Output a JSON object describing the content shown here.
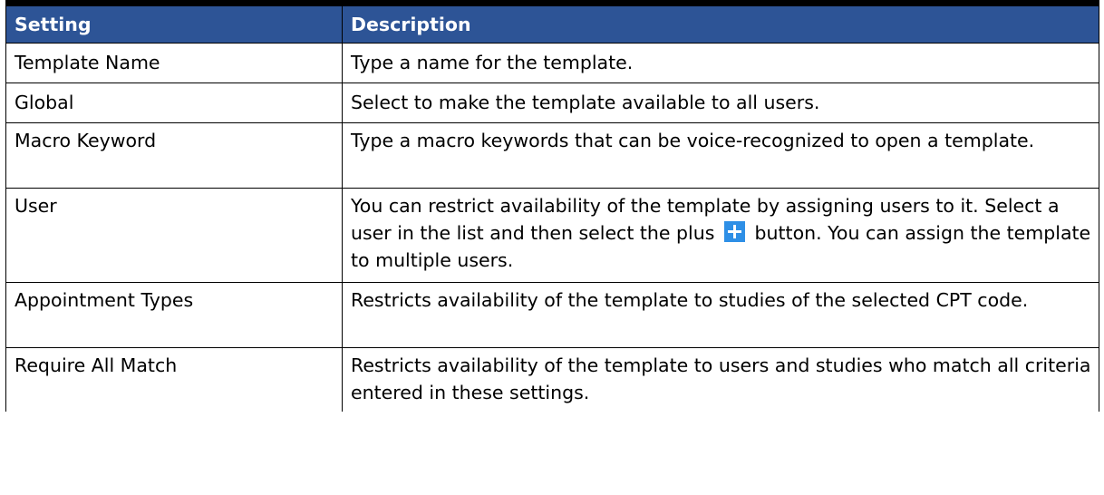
{
  "table": {
    "headers": {
      "setting": "Setting",
      "description": "Description"
    },
    "rows": [
      {
        "setting": "Template Name",
        "description": "Type a name for the template."
      },
      {
        "setting": "Global",
        "description": "Select to make the template available to all users."
      },
      {
        "setting": "Macro Keyword",
        "description": "Type a macro keywords that can be voice-recognized to open a template."
      },
      {
        "setting": "User",
        "description_before_icon": "You can restrict availability of the template by assigning users to it. Select a user in the list and then select the plus",
        "icon": "plus-icon",
        "description_after_icon": "button. You can assign the template to multiple users."
      },
      {
        "setting": "Appointment Types",
        "description": "Restricts availability of the template to studies of the selected CPT code."
      },
      {
        "setting": "Require All Match",
        "description": "Restricts availability of the template to users and studies who match all criteria entered in these settings."
      }
    ]
  },
  "colors": {
    "header_background": "#2d5496",
    "header_text": "#ffffff",
    "plus_icon": "#2e8fe6"
  }
}
